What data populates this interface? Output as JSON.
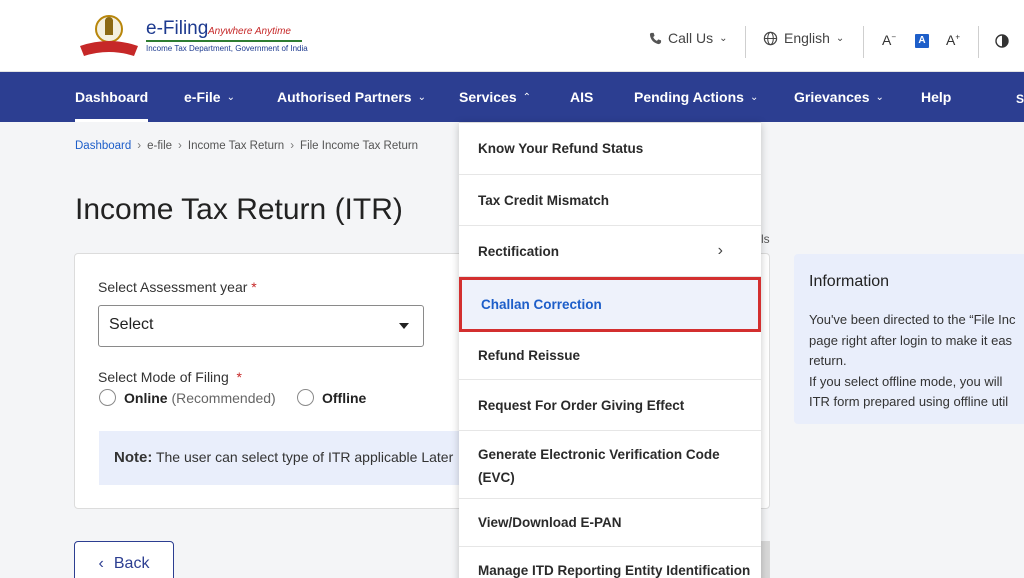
{
  "brand": {
    "title": "e-Filing",
    "tagline": "Anywhere Anytime",
    "subtitle": "Income Tax Department, Government of India"
  },
  "header": {
    "call_us": "Call Us",
    "language": "English",
    "font_decrease": "A",
    "font_normal": "A",
    "font_increase": "A"
  },
  "nav": {
    "items": [
      {
        "label": "Dashboard"
      },
      {
        "label": "e-File"
      },
      {
        "label": "Authorised Partners"
      },
      {
        "label": "Services"
      },
      {
        "label": "AIS"
      },
      {
        "label": "Pending Actions"
      },
      {
        "label": "Grievances"
      },
      {
        "label": "Help"
      },
      {
        "label": "S"
      }
    ]
  },
  "breadcrumb": [
    "Dashboard",
    "e-file",
    "Income Tax Return",
    "File Income Tax Return"
  ],
  "page_title": "Income Tax Return (ITR)",
  "form": {
    "assessment_label": "Select Assessment year",
    "assessment_value": "Select",
    "mode_label": "Select Mode of Filing",
    "required_mark": "*",
    "online_label": "Online",
    "online_hint": "(Recommended)",
    "offline_label": "Offline",
    "note_label": "Note:",
    "note_text": "The user can select type of ITR applicable Later"
  },
  "stray_text": "ls",
  "info": {
    "title": "Information",
    "lines": [
      "You've been directed to the “File Inc",
      "page right after login to make it eas",
      "return.",
      "If you select offline mode, you will",
      "ITR form prepared using offline util"
    ]
  },
  "back_label": "Back",
  "services_menu": {
    "items": [
      "Know Your Refund Status",
      "Tax Credit Mismatch",
      "Rectification",
      "Challan Correction",
      "Refund Reissue",
      "Request For Order Giving Effect",
      "Generate Electronic Verification Code (EVC)",
      "View/Download E-PAN",
      "Manage ITD Reporting Entity Identification"
    ],
    "highlighted_index": 3
  },
  "colors": {
    "nav_bg": "#2c3e91",
    "accent": "#1d5ec9",
    "highlight_border": "#d32f2f",
    "info_bg": "#e9eefb"
  }
}
